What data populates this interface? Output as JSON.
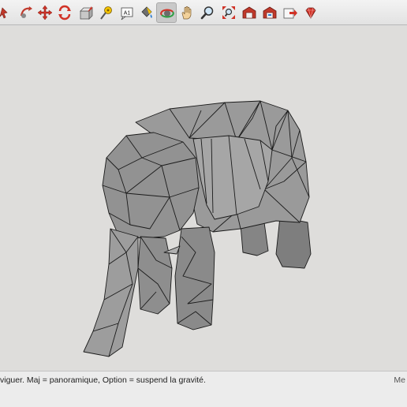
{
  "toolbar": {
    "tools": [
      {
        "name": "move",
        "icon": "move-arrows-icon"
      },
      {
        "name": "rotate",
        "icon": "rotate-icon"
      },
      {
        "name": "push-pull",
        "icon": "push-pull-icon"
      },
      {
        "name": "tape-measure",
        "icon": "tape-measure-icon"
      },
      {
        "name": "text",
        "icon": "text-icon"
      },
      {
        "name": "paint-bucket",
        "icon": "paint-bucket-icon"
      },
      {
        "name": "orbit",
        "icon": "orbit-icon",
        "active": true
      },
      {
        "name": "pan",
        "icon": "pan-hand-icon"
      },
      {
        "name": "zoom",
        "icon": "zoom-icon"
      },
      {
        "name": "zoom-extents",
        "icon": "zoom-extents-icon"
      },
      {
        "name": "warehouse",
        "icon": "warehouse-icon"
      },
      {
        "name": "extension-warehouse",
        "icon": "extension-warehouse-icon"
      },
      {
        "name": "share-model",
        "icon": "share-model-icon"
      },
      {
        "name": "ruby",
        "icon": "ruby-icon"
      }
    ],
    "text_tool_label": "A1"
  },
  "status": {
    "hint": "viguer. Maj = panoramique, Option =  suspend la gravité.",
    "measurements_label": "Me"
  },
  "colors": {
    "model_fill": "#8f8f8f",
    "edge": "#1a1a1a",
    "background": "#dedddb"
  }
}
